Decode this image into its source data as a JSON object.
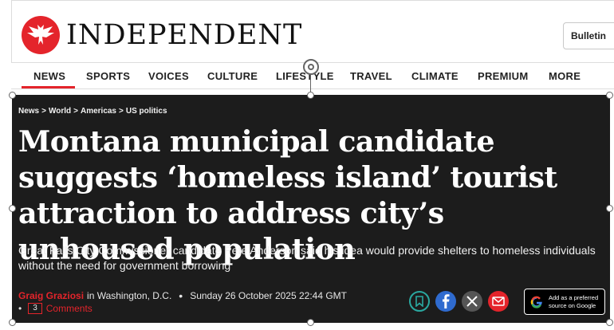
{
  "masthead": {
    "logo_text": "INDEPENDENT",
    "bulletin_label": "Bulletin"
  },
  "nav": {
    "items": [
      {
        "label": "NEWS",
        "active": true
      },
      {
        "label": "SPORTS"
      },
      {
        "label": "VOICES"
      },
      {
        "label": "CULTURE"
      },
      {
        "label": "LIFESTYLE"
      },
      {
        "label": "TRAVEL"
      },
      {
        "label": "CLIMATE"
      },
      {
        "label": "PREMIUM"
      },
      {
        "label": "MORE"
      }
    ]
  },
  "article": {
    "breadcrumb": [
      "News",
      "World",
      "Americas",
      "US politics"
    ],
    "headline": "Montana municipal candidate suggests ‘homeless island’ tourist attraction to address city’s unhoused population",
    "standfirst": "Great Falls City Commissioner candidate Pete Anderson said his idea would provide shelters to homeless individuals without the need for government borrowing",
    "author": "Graig Graziosi",
    "location": "in Washington, D.C.",
    "date": "Sunday 26 October 2025 22:44 GMT",
    "comments_count": "3",
    "comments_label": "Comments",
    "google_pref_line1": "Add as a preferred",
    "google_pref_line2": "source on Google"
  },
  "icons": {
    "share": [
      "bookmark-icon",
      "facebook-icon",
      "x-icon",
      "email-icon"
    ]
  },
  "colors": {
    "brand_red": "#e4242b",
    "article_bg": "#1c1c1c",
    "facebook_blue": "#2f6bcf"
  }
}
